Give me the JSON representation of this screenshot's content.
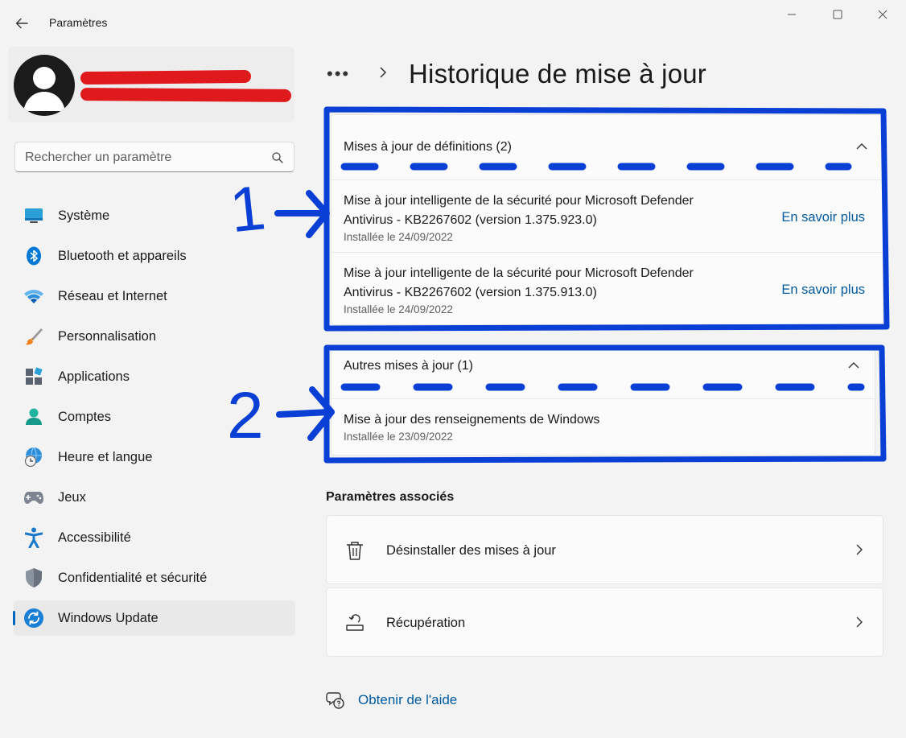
{
  "window": {
    "title": "Paramètres",
    "back_icon": "back-arrow-icon"
  },
  "search": {
    "placeholder": "Rechercher un paramètre"
  },
  "sidebar": {
    "items": [
      {
        "label": "Système",
        "icon": "system-monitor-icon"
      },
      {
        "label": "Bluetooth et appareils",
        "icon": "bluetooth-icon"
      },
      {
        "label": "Réseau et Internet",
        "icon": "wifi-icon"
      },
      {
        "label": "Personnalisation",
        "icon": "paintbrush-icon"
      },
      {
        "label": "Applications",
        "icon": "apps-icon"
      },
      {
        "label": "Comptes",
        "icon": "account-icon"
      },
      {
        "label": "Heure et langue",
        "icon": "globe-clock-icon"
      },
      {
        "label": "Jeux",
        "icon": "gamepad-icon"
      },
      {
        "label": "Accessibilité",
        "icon": "accessibility-icon"
      },
      {
        "label": "Confidentialité et sécurité",
        "icon": "shield-icon"
      },
      {
        "label": "Windows Update",
        "icon": "windows-update-icon",
        "active": true
      }
    ]
  },
  "breadcrumb": {
    "overflow": "•••",
    "title": "Historique de mise à jour"
  },
  "groups": [
    {
      "title": "Mises à jour de définitions (2)",
      "items": [
        {
          "name_line1": "Mise à jour intelligente de la sécurité pour Microsoft Defender",
          "name_line2": "Antivirus - KB2267602 (version 1.375.923.0)",
          "date": "Installée le 24/09/2022",
          "link": "En savoir plus"
        },
        {
          "name_line1": "Mise à jour intelligente de la sécurité pour Microsoft Defender",
          "name_line2": "Antivirus - KB2267602 (version 1.375.913.0)",
          "date": "Installée le 24/09/2022",
          "link": "En savoir plus"
        }
      ]
    },
    {
      "title": "Autres mises à jour (1)",
      "items": [
        {
          "name_line1": "Mise à jour des renseignements de Windows",
          "date": "Installée le 23/09/2022"
        }
      ]
    }
  ],
  "related": {
    "title": "Paramètres associés",
    "items": [
      {
        "label": "Désinstaller des mises à jour",
        "icon": "trash-icon"
      },
      {
        "label": "Récupération",
        "icon": "recovery-icon"
      }
    ]
  },
  "help": {
    "label": "Obtenir de l'aide",
    "icon": "help-chat-icon"
  },
  "annotations": {
    "label_1": "1",
    "label_2": "2",
    "color": "#0a3fd6"
  },
  "colors": {
    "accent": "#0067c0",
    "link": "#005a9e",
    "redaction": "#e0191c"
  }
}
